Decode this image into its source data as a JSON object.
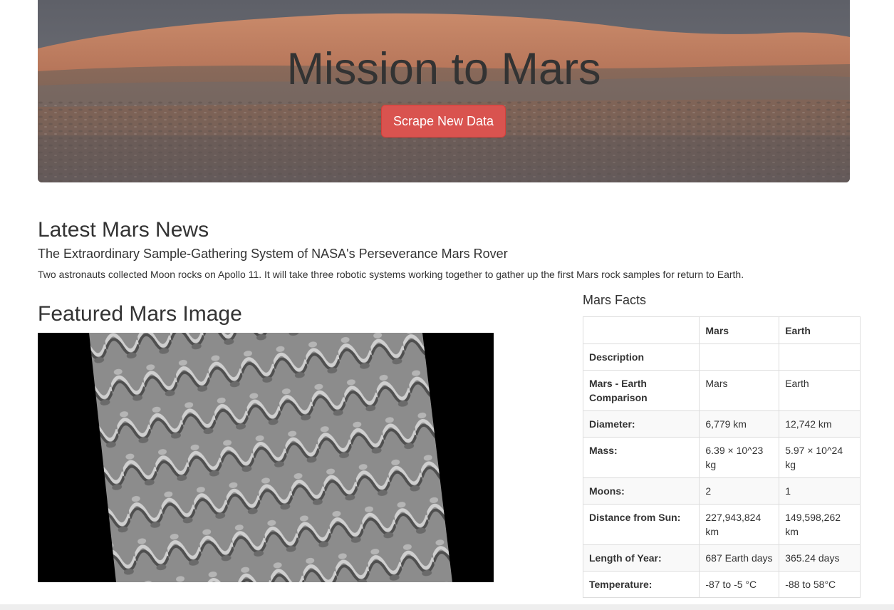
{
  "header": {
    "title": "Mission to Mars",
    "scrape_button": "Scrape New Data"
  },
  "news": {
    "heading": "Latest Mars News",
    "title": "The Extraordinary Sample-Gathering System of NASA's Perseverance Mars Rover",
    "paragraph": "Two astronauts collected Moon rocks on Apollo 11. It will take three robotic systems working together to gather up the first Mars rock samples for return to Earth."
  },
  "featured": {
    "heading": "Featured Mars Image"
  },
  "facts": {
    "heading": "Mars Facts",
    "columns": [
      "",
      "Mars",
      "Earth"
    ],
    "rows": [
      {
        "label": "Description",
        "mars": "",
        "earth": ""
      },
      {
        "label": "Mars - Earth Comparison",
        "mars": "Mars",
        "earth": "Earth"
      },
      {
        "label": "Diameter:",
        "mars": "6,779 km",
        "earth": "12,742 km"
      },
      {
        "label": "Mass:",
        "mars": "6.39 × 10^23 kg",
        "earth": "5.97 × 10^24 kg"
      },
      {
        "label": "Moons:",
        "mars": "2",
        "earth": "1"
      },
      {
        "label": "Distance from Sun:",
        "mars": "227,943,824 km",
        "earth": "149,598,262 km"
      },
      {
        "label": "Length of Year:",
        "mars": "687 Earth days",
        "earth": "365.24 days"
      },
      {
        "label": "Temperature:",
        "mars": "-87 to -5 °C",
        "earth": "-88 to 58°C"
      }
    ]
  },
  "colors": {
    "button": "#d9534f",
    "text": "#333333"
  }
}
